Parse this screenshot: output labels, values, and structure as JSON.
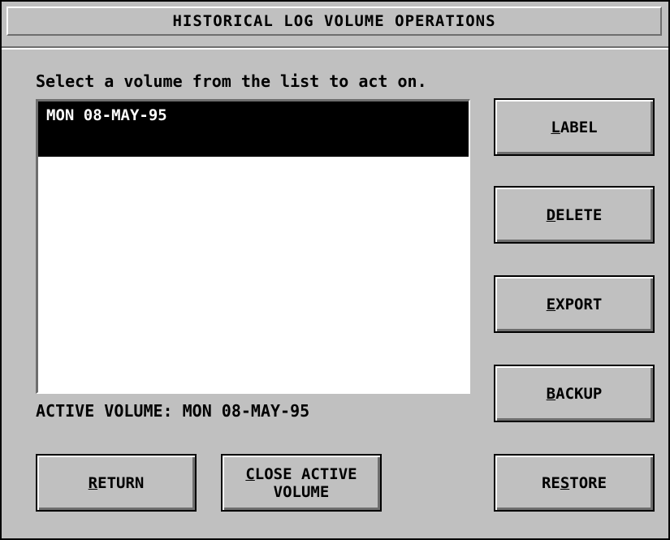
{
  "window": {
    "title": "HISTORICAL LOG VOLUME OPERATIONS"
  },
  "instruction": "Select a volume from the list to act on.",
  "volume_list": {
    "items": [
      "MON 08-MAY-95"
    ],
    "selected_index": 0
  },
  "active_volume": "ACTIVE VOLUME: MON 08-MAY-95",
  "buttons": {
    "label": {
      "pre": "",
      "accel": "L",
      "post": "ABEL"
    },
    "delete": {
      "pre": "",
      "accel": "D",
      "post": "ELETE"
    },
    "export": {
      "pre": "",
      "accel": "E",
      "post": "XPORT"
    },
    "backup": {
      "pre": "",
      "accel": "B",
      "post": "ACKUP"
    },
    "restore": {
      "pre": "RE",
      "accel": "S",
      "post": "TORE"
    },
    "return": {
      "pre": "",
      "accel": "R",
      "post": "ETURN"
    },
    "close_active": {
      "pre": "",
      "accel": "C",
      "post": "LOSE ACTIVE",
      "line2": "VOLUME"
    }
  },
  "colors": {
    "face": "#c0c0c0",
    "selection": "#000000",
    "list_bg": "#ffffff"
  }
}
